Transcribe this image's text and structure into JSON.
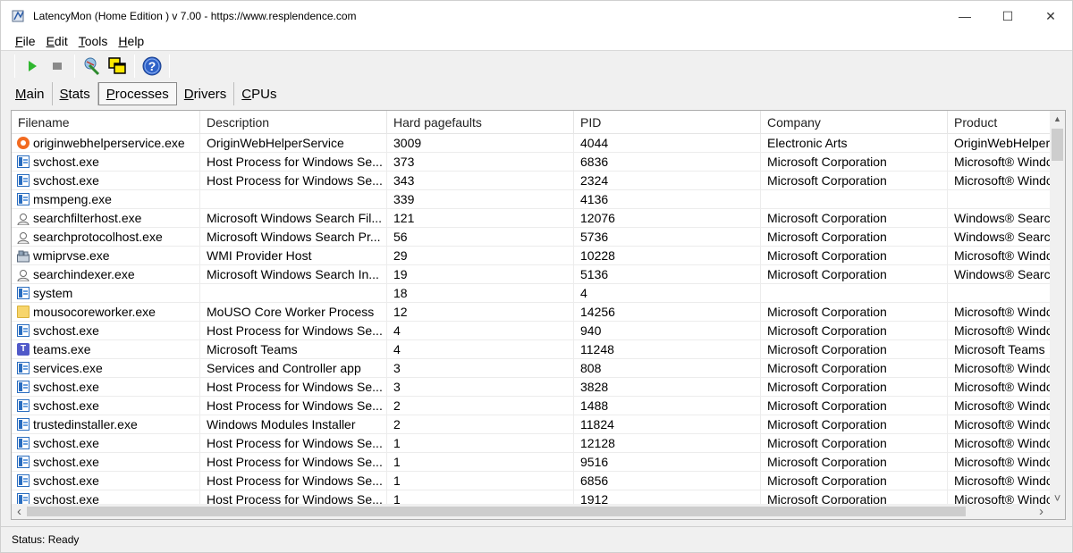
{
  "window": {
    "title": "LatencyMon  (Home Edition )  v 7.00 - https://www.resplendence.com",
    "minimize": "—",
    "maximize": "☐",
    "close": "✕"
  },
  "menu": [
    {
      "underline": "F",
      "rest": "ile"
    },
    {
      "underline": "E",
      "rest": "dit"
    },
    {
      "underline": "T",
      "rest": "ools"
    },
    {
      "underline": "H",
      "rest": "elp"
    }
  ],
  "toolbar": {
    "start": "start-icon",
    "stop": "stop-icon",
    "settings": "wand-icon",
    "windows": "windows-icon",
    "help": "help-icon",
    "play_color": "#2fb72f",
    "stop_color": "#8a8a8a"
  },
  "tabs": [
    {
      "underline": "M",
      "rest": "ain"
    },
    {
      "underline": "S",
      "rest": "tats"
    },
    {
      "underline": "P",
      "rest": "rocesses"
    },
    {
      "underline": "D",
      "rest": "rivers"
    },
    {
      "underline": "C",
      "rest": "PUs"
    }
  ],
  "table": {
    "columns": [
      "Filename",
      "Description",
      "Hard pagefaults",
      "PID",
      "Company",
      "Product"
    ],
    "rows": [
      {
        "icon": "origin",
        "filename": "originwebhelperservice.exe",
        "description": "OriginWebHelperService",
        "faults": "3009",
        "pid": "4044",
        "company": "Electronic Arts",
        "product": "OriginWebHelperS"
      },
      {
        "icon": "svc",
        "filename": "svchost.exe",
        "description": "Host Process for Windows Se...",
        "faults": "373",
        "pid": "6836",
        "company": "Microsoft Corporation",
        "product": "Microsoft® Windc"
      },
      {
        "icon": "svc",
        "filename": "svchost.exe",
        "description": "Host Process for Windows Se...",
        "faults": "343",
        "pid": "2324",
        "company": "Microsoft Corporation",
        "product": "Microsoft® Windc"
      },
      {
        "icon": "svc",
        "filename": "msmpeng.exe",
        "description": "",
        "faults": "339",
        "pid": "4136",
        "company": "",
        "product": ""
      },
      {
        "icon": "search",
        "filename": "searchfilterhost.exe",
        "description": "Microsoft Windows Search Fil...",
        "faults": "121",
        "pid": "12076",
        "company": "Microsoft Corporation",
        "product": "Windows® Searc"
      },
      {
        "icon": "search",
        "filename": "searchprotocolhost.exe",
        "description": "Microsoft Windows Search Pr...",
        "faults": "56",
        "pid": "5736",
        "company": "Microsoft Corporation",
        "product": "Windows® Searc"
      },
      {
        "icon": "wmi",
        "filename": "wmiprvse.exe",
        "description": "WMI Provider Host",
        "faults": "29",
        "pid": "10228",
        "company": "Microsoft Corporation",
        "product": "Microsoft® Windc"
      },
      {
        "icon": "search",
        "filename": "searchindexer.exe",
        "description": "Microsoft Windows Search In...",
        "faults": "19",
        "pid": "5136",
        "company": "Microsoft Corporation",
        "product": "Windows® Searc"
      },
      {
        "icon": "svc",
        "filename": "system",
        "description": "",
        "faults": "18",
        "pid": "4",
        "company": "",
        "product": ""
      },
      {
        "icon": "folder",
        "filename": "mousocoreworker.exe",
        "description": "MoUSO Core Worker Process",
        "faults": "12",
        "pid": "14256",
        "company": "Microsoft Corporation",
        "product": "Microsoft® Windc"
      },
      {
        "icon": "svc",
        "filename": "svchost.exe",
        "description": "Host Process for Windows Se...",
        "faults": "4",
        "pid": "940",
        "company": "Microsoft Corporation",
        "product": "Microsoft® Windc"
      },
      {
        "icon": "teams",
        "filename": "teams.exe",
        "description": "Microsoft Teams",
        "faults": "4",
        "pid": "11248",
        "company": "Microsoft Corporation",
        "product": "Microsoft Teams"
      },
      {
        "icon": "svc",
        "filename": "services.exe",
        "description": "Services and Controller app",
        "faults": "3",
        "pid": "808",
        "company": "Microsoft Corporation",
        "product": "Microsoft® Windc"
      },
      {
        "icon": "svc",
        "filename": "svchost.exe",
        "description": "Host Process for Windows Se...",
        "faults": "3",
        "pid": "3828",
        "company": "Microsoft Corporation",
        "product": "Microsoft® Windc"
      },
      {
        "icon": "svc",
        "filename": "svchost.exe",
        "description": "Host Process for Windows Se...",
        "faults": "2",
        "pid": "1488",
        "company": "Microsoft Corporation",
        "product": "Microsoft® Windc"
      },
      {
        "icon": "svc",
        "filename": "trustedinstaller.exe",
        "description": "Windows Modules Installer",
        "faults": "2",
        "pid": "11824",
        "company": "Microsoft Corporation",
        "product": "Microsoft® Windc"
      },
      {
        "icon": "svc",
        "filename": "svchost.exe",
        "description": "Host Process for Windows Se...",
        "faults": "1",
        "pid": "12128",
        "company": "Microsoft Corporation",
        "product": "Microsoft® Windc"
      },
      {
        "icon": "svc",
        "filename": "svchost.exe",
        "description": "Host Process for Windows Se...",
        "faults": "1",
        "pid": "9516",
        "company": "Microsoft Corporation",
        "product": "Microsoft® Windc"
      },
      {
        "icon": "svc",
        "filename": "svchost.exe",
        "description": "Host Process for Windows Se...",
        "faults": "1",
        "pid": "6856",
        "company": "Microsoft Corporation",
        "product": "Microsoft® Windc"
      },
      {
        "icon": "svc",
        "filename": "svchost.exe",
        "description": "Host Process for Windows Se...",
        "faults": "1",
        "pid": "1912",
        "company": "Microsoft Corporation",
        "product": "Microsoft® Windc"
      }
    ]
  },
  "scrollbars": {
    "up": "▲",
    "down": "˅",
    "left": "‹",
    "right": "›"
  },
  "status": "Status: Ready"
}
